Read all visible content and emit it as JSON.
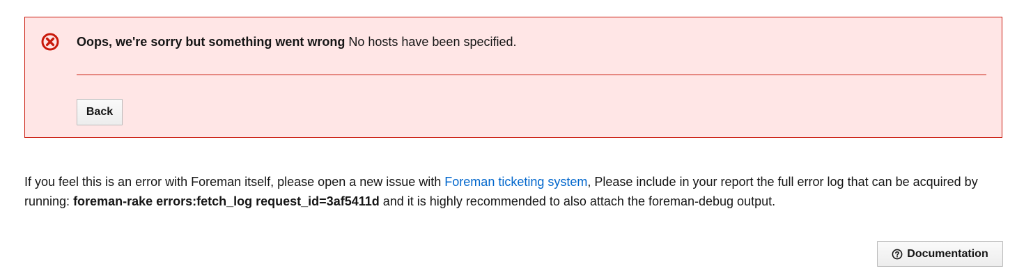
{
  "alert": {
    "icon": "error-circle-icon",
    "title": "Oops, we're sorry but something went wrong",
    "message": "No hosts have been specified.",
    "back_label": "Back",
    "colors": {
      "background": "#ffe6e6",
      "border": "#c9190b",
      "icon": "#c9190b"
    }
  },
  "info": {
    "prefix": "If you feel this is an error with Foreman itself, please open a new issue with ",
    "link_text": "Foreman ticketing system",
    "middle": ", Please include in your report the full error log that can be acquired by running: ",
    "command": "foreman-rake errors:fetch_log request_id=3af5411d",
    "suffix": " and it is highly recommended to also attach the foreman-debug output.",
    "link_color": "#0066cc"
  },
  "documentation": {
    "icon": "help-circle-icon",
    "label": "Documentation"
  }
}
